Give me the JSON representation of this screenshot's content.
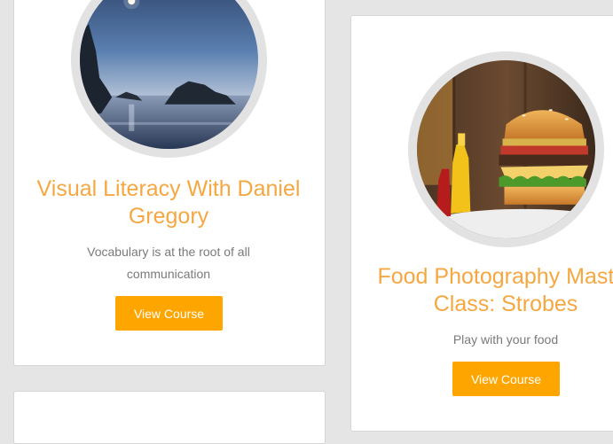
{
  "courses": [
    {
      "title": "Visual Literacy With Daniel Gregory",
      "description": "Vocabulary is at the root of all communication",
      "button_label": "View Course",
      "image": "seascape-moon-photo"
    },
    {
      "title": "Food Photography Master Class: Strobes",
      "description": "Play with your food",
      "button_label": "View Course",
      "image": "burger-photo"
    }
  ],
  "colors": {
    "background": "#e6e5e5",
    "card": "#ffffff",
    "title": "#f5a741",
    "button": "#ffa500",
    "description": "#7a7a7a"
  }
}
